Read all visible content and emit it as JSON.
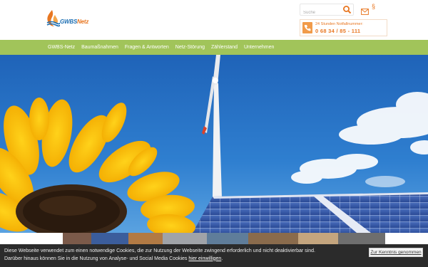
{
  "header": {
    "logo": {
      "brand": "GWBS",
      "brand_accent": "Netz"
    },
    "search": {
      "placeholder": "Suche"
    },
    "hotline": {
      "label": "24 Stunden Notfallnummer:",
      "number": "0 68 34 / 85 - 111"
    }
  },
  "nav": {
    "items": [
      "GWBS-Netz",
      "Baumaßnahmen",
      "Fragen & Antworten",
      "Netz-Störung",
      "Zählerstand",
      "Unternehmen"
    ]
  },
  "cookie": {
    "text": "Diese Webseite verwendet zum einen notwendige Cookies, die zur Nutzung der Webseite zwingend erforderlich und nicht deaktivierbar sind. Darüber hinaus können Sie in die Nutzung von Analyse- und Social Media Cookies",
    "link": "hier einwilligen",
    "text_end": ".",
    "button": "Zur Kenntnis genommen"
  },
  "colors": {
    "accent_orange": "#e87722",
    "brand_blue": "#1d6fb3",
    "nav_green": "#a1c45a",
    "cookie_bg": "#2b2b2b"
  },
  "icons": [
    "logo-flame-icon",
    "search-icon",
    "mail-icon",
    "paragraph-icon",
    "phone-icon"
  ]
}
